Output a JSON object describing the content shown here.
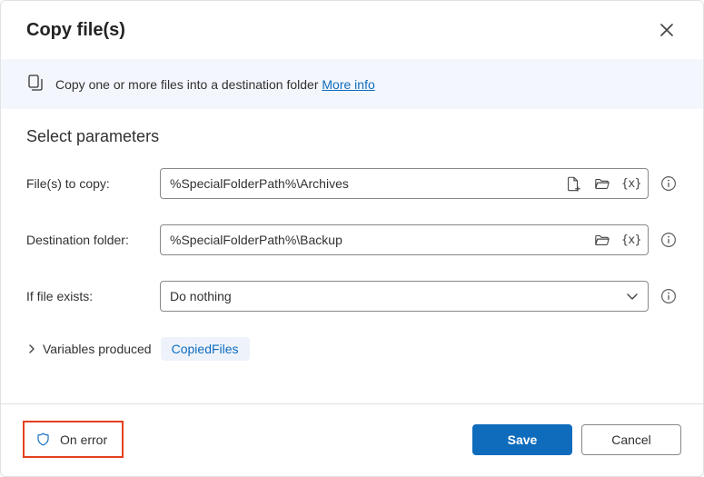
{
  "dialog": {
    "title": "Copy file(s)"
  },
  "banner": {
    "text": "Copy one or more files into a destination folder ",
    "more_info": "More info"
  },
  "section": {
    "title": "Select parameters"
  },
  "fields": {
    "files_to_copy": {
      "label": "File(s) to copy:",
      "value": "%SpecialFolderPath%\\Archives"
    },
    "destination_folder": {
      "label": "Destination folder:",
      "value": "%SpecialFolderPath%\\Backup"
    },
    "if_file_exists": {
      "label": "If file exists:",
      "value": "Do nothing"
    }
  },
  "variables_produced": {
    "label": "Variables produced",
    "chip": "CopiedFiles"
  },
  "footer": {
    "on_error": "On error",
    "save": "Save",
    "cancel": "Cancel"
  },
  "icons": {
    "variable_token": "{x}"
  }
}
